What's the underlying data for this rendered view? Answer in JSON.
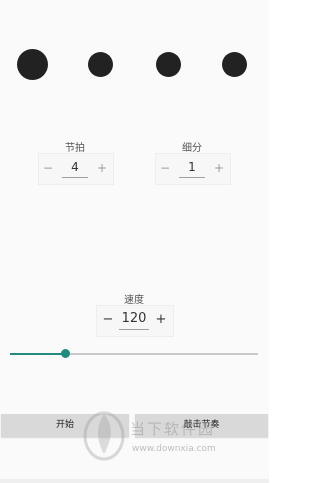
{
  "beats": {
    "count_visible": 4
  },
  "meter": {
    "label": "节拍",
    "minus": "−",
    "value": "4",
    "plus": "+"
  },
  "subdivision": {
    "label": "细分",
    "minus": "−",
    "value": "1",
    "plus": "+"
  },
  "tempo": {
    "label": "速度",
    "minus": "−",
    "value": "120",
    "plus": "+",
    "slider_level": 0.22
  },
  "buttons": {
    "start": "开始",
    "tap": "敲击节奏"
  },
  "watermark": {
    "text": "当下软件园",
    "url": "www.downxia.com"
  },
  "colors": {
    "accent": "#1f8a7d",
    "dot": "#222222"
  }
}
